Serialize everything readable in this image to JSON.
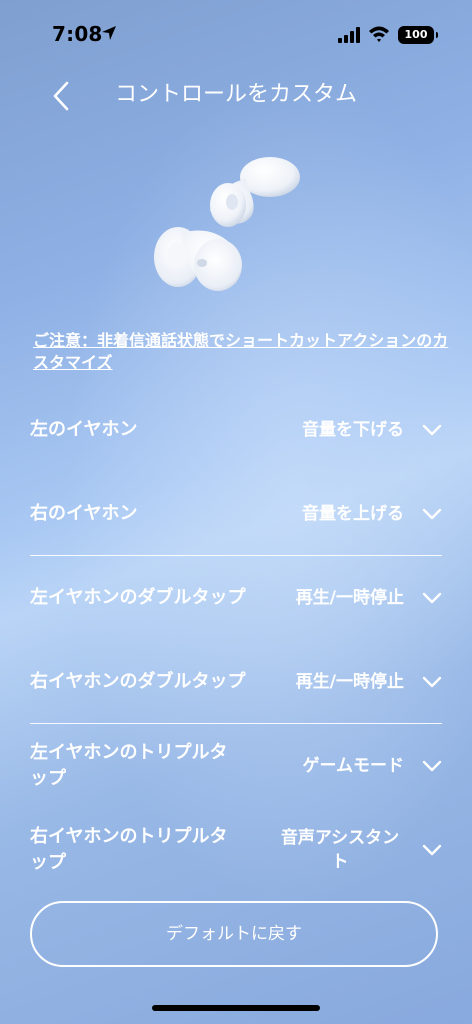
{
  "status_bar": {
    "time": "7:08",
    "battery": "100"
  },
  "header": {
    "back_icon": "chevron-left-icon",
    "title": "コントロールをカスタム"
  },
  "product": {
    "image_icon": "earbuds-image"
  },
  "notice": {
    "text": "ご注意：非着信通話状態でショートカットアクションのカスタマイズ"
  },
  "settings": [
    {
      "label": "左のイヤホン",
      "value": "音量を下げる"
    },
    {
      "label": "右のイヤホン",
      "value": "音量を上げる"
    },
    {
      "label": "左イヤホンのダブルタップ",
      "value": "再生/一時停止"
    },
    {
      "label": "右イヤホンのダブルタップ",
      "value": "再生/一時停止"
    },
    {
      "label": "左イヤホンのトリプルタップ",
      "value": "ゲームモード"
    },
    {
      "label": "右イヤホンのトリプルタップ",
      "value": "音声アシスタント"
    }
  ],
  "reset_button": {
    "label": "デフォルトに戻す"
  },
  "colors": {
    "background_start": "#7f9fd0",
    "background_mid": "#b9d4f6",
    "text": "#ffffff"
  }
}
